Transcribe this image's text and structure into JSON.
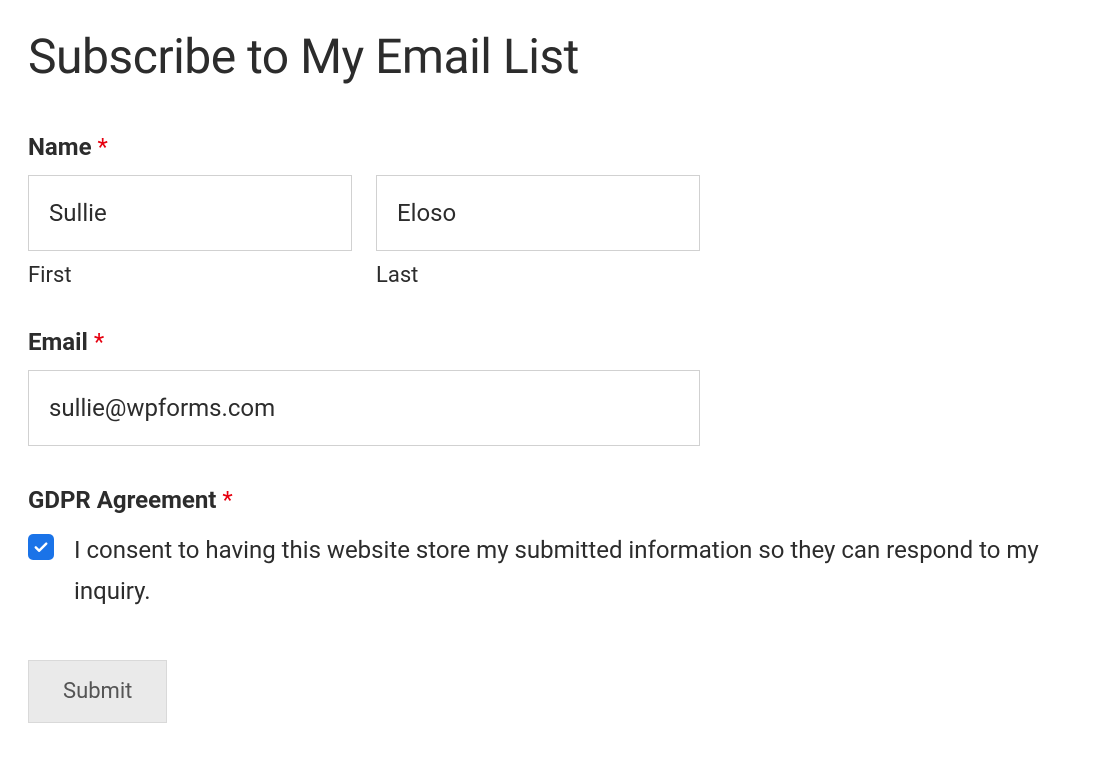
{
  "title": "Subscribe to My Email List",
  "fields": {
    "name": {
      "label": "Name",
      "required_marker": "*",
      "first": {
        "value": "Sullie",
        "sublabel": "First"
      },
      "last": {
        "value": "Eloso",
        "sublabel": "Last"
      }
    },
    "email": {
      "label": "Email",
      "required_marker": "*",
      "value": "sullie@wpforms.com"
    },
    "gdpr": {
      "label": "GDPR Agreement",
      "required_marker": "*",
      "checked": true,
      "consent_text": "I consent to having this website store my submitted information so they can respond to my inquiry."
    }
  },
  "submit_label": "Submit",
  "colors": {
    "required": "#e6000f",
    "checkbox_bg": "#1a73e8",
    "submit_bg": "#eaeaea",
    "input_border": "#d1d1d1"
  }
}
